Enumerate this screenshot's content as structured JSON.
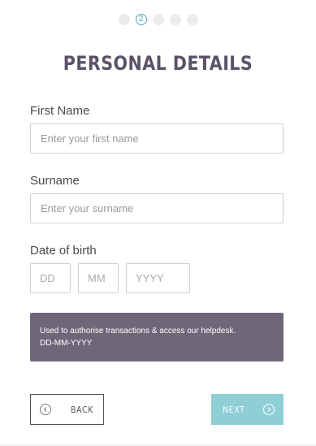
{
  "stepper": {
    "steps": [
      "",
      "2",
      "",
      "",
      ""
    ],
    "current_label": "2",
    "accent_color": "#4aa9bb"
  },
  "header": {
    "title": "PERSONAL DETAILS"
  },
  "form": {
    "first_name": {
      "label": "First Name",
      "placeholder": "Enter your first name",
      "value": ""
    },
    "surname": {
      "label": "Surname",
      "placeholder": "Enter your surname",
      "value": ""
    },
    "dob": {
      "label": "Date of birth",
      "day_placeholder": "DD",
      "month_placeholder": "MM",
      "year_placeholder": "YYYY"
    }
  },
  "info": {
    "line1": "Used to authorise transactions & access our helpdesk.",
    "line2": "DD-MM-YYYY",
    "background_color": "#6f6779"
  },
  "actions": {
    "back_label": "BACK",
    "back_icon": "chevron-left-circle-icon",
    "next_label": "NEXT",
    "next_icon": "chevron-right-circle-icon",
    "next_color": "#8ecfd6"
  }
}
